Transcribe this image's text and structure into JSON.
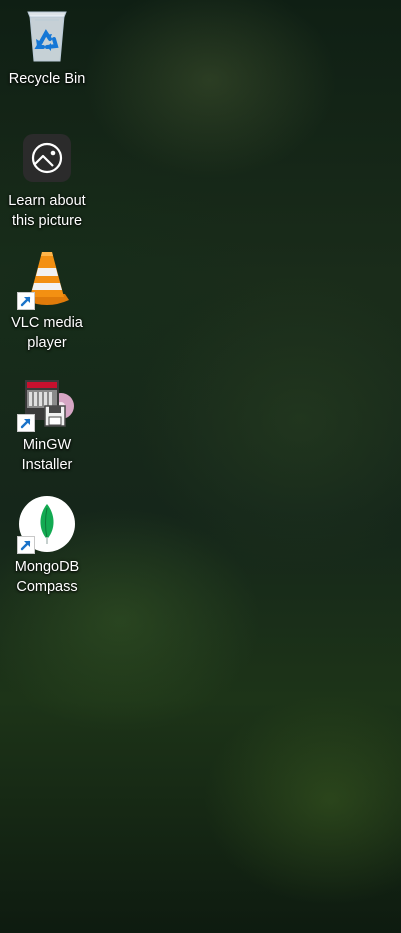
{
  "desktop": {
    "icons": [
      {
        "label": "Recycle Bin",
        "icon": "recycle-bin-icon",
        "shortcut": false
      },
      {
        "label": "Learn about\nthis picture",
        "icon": "learn-about-picture-icon",
        "shortcut": false
      },
      {
        "label": "VLC media\nplayer",
        "icon": "vlc-cone-icon",
        "shortcut": true
      },
      {
        "label": "MinGW\nInstaller",
        "icon": "mingw-installer-icon",
        "shortcut": true
      },
      {
        "label": "MongoDB\nCompass",
        "icon": "mongodb-leaf-icon",
        "shortcut": true
      }
    ]
  },
  "colors": {
    "label_text": "#ffffff",
    "shortcut_arrow": "#1a73c9",
    "vlc_orange": "#f08a0c",
    "mongodb_green": "#13aa52"
  }
}
